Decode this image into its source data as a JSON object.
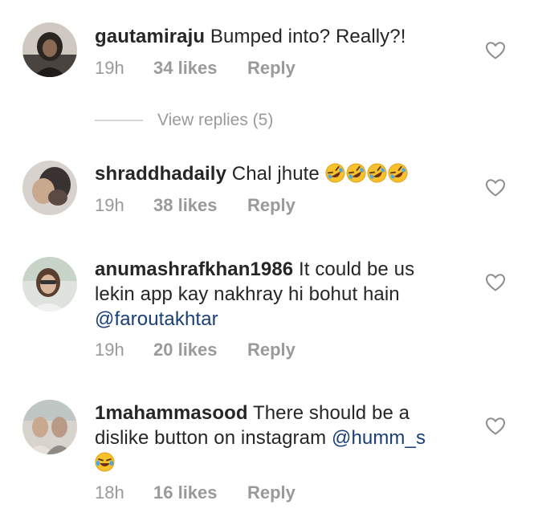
{
  "comments": [
    {
      "username": "gautamiraju",
      "text": "Bumped into? Really?!",
      "time": "19h",
      "likes": "34 likes",
      "reply_label": "Reply",
      "view_replies": "View replies (5)"
    },
    {
      "username": "shraddhadaily",
      "text": "Chal jhute",
      "emojis": [
        "rofl-emoji",
        "rofl-emoji",
        "rofl-emoji",
        "rofl-emoji"
      ],
      "time": "19h",
      "likes": "38 likes",
      "reply_label": "Reply"
    },
    {
      "username": "anumashrafkhan1986",
      "text": "It could be us lekin app kay nakhray hi bohut hain",
      "mention": "@faroutakhtar",
      "time": "19h",
      "likes": "20 likes",
      "reply_label": "Reply"
    },
    {
      "username": "1mahammasood",
      "text": "There should be a dislike button on instagram",
      "mention": "@humm_s",
      "emojis": [
        "tears-of-joy-emoji"
      ],
      "time": "18h",
      "likes": "16 likes",
      "reply_label": "Reply"
    }
  ],
  "icons": {
    "like": "heart-outline-icon"
  },
  "colors": {
    "username": "#262626",
    "meta": "#9a9a9a",
    "mention": "#1a3f78",
    "heart": "#8e8e8e"
  }
}
